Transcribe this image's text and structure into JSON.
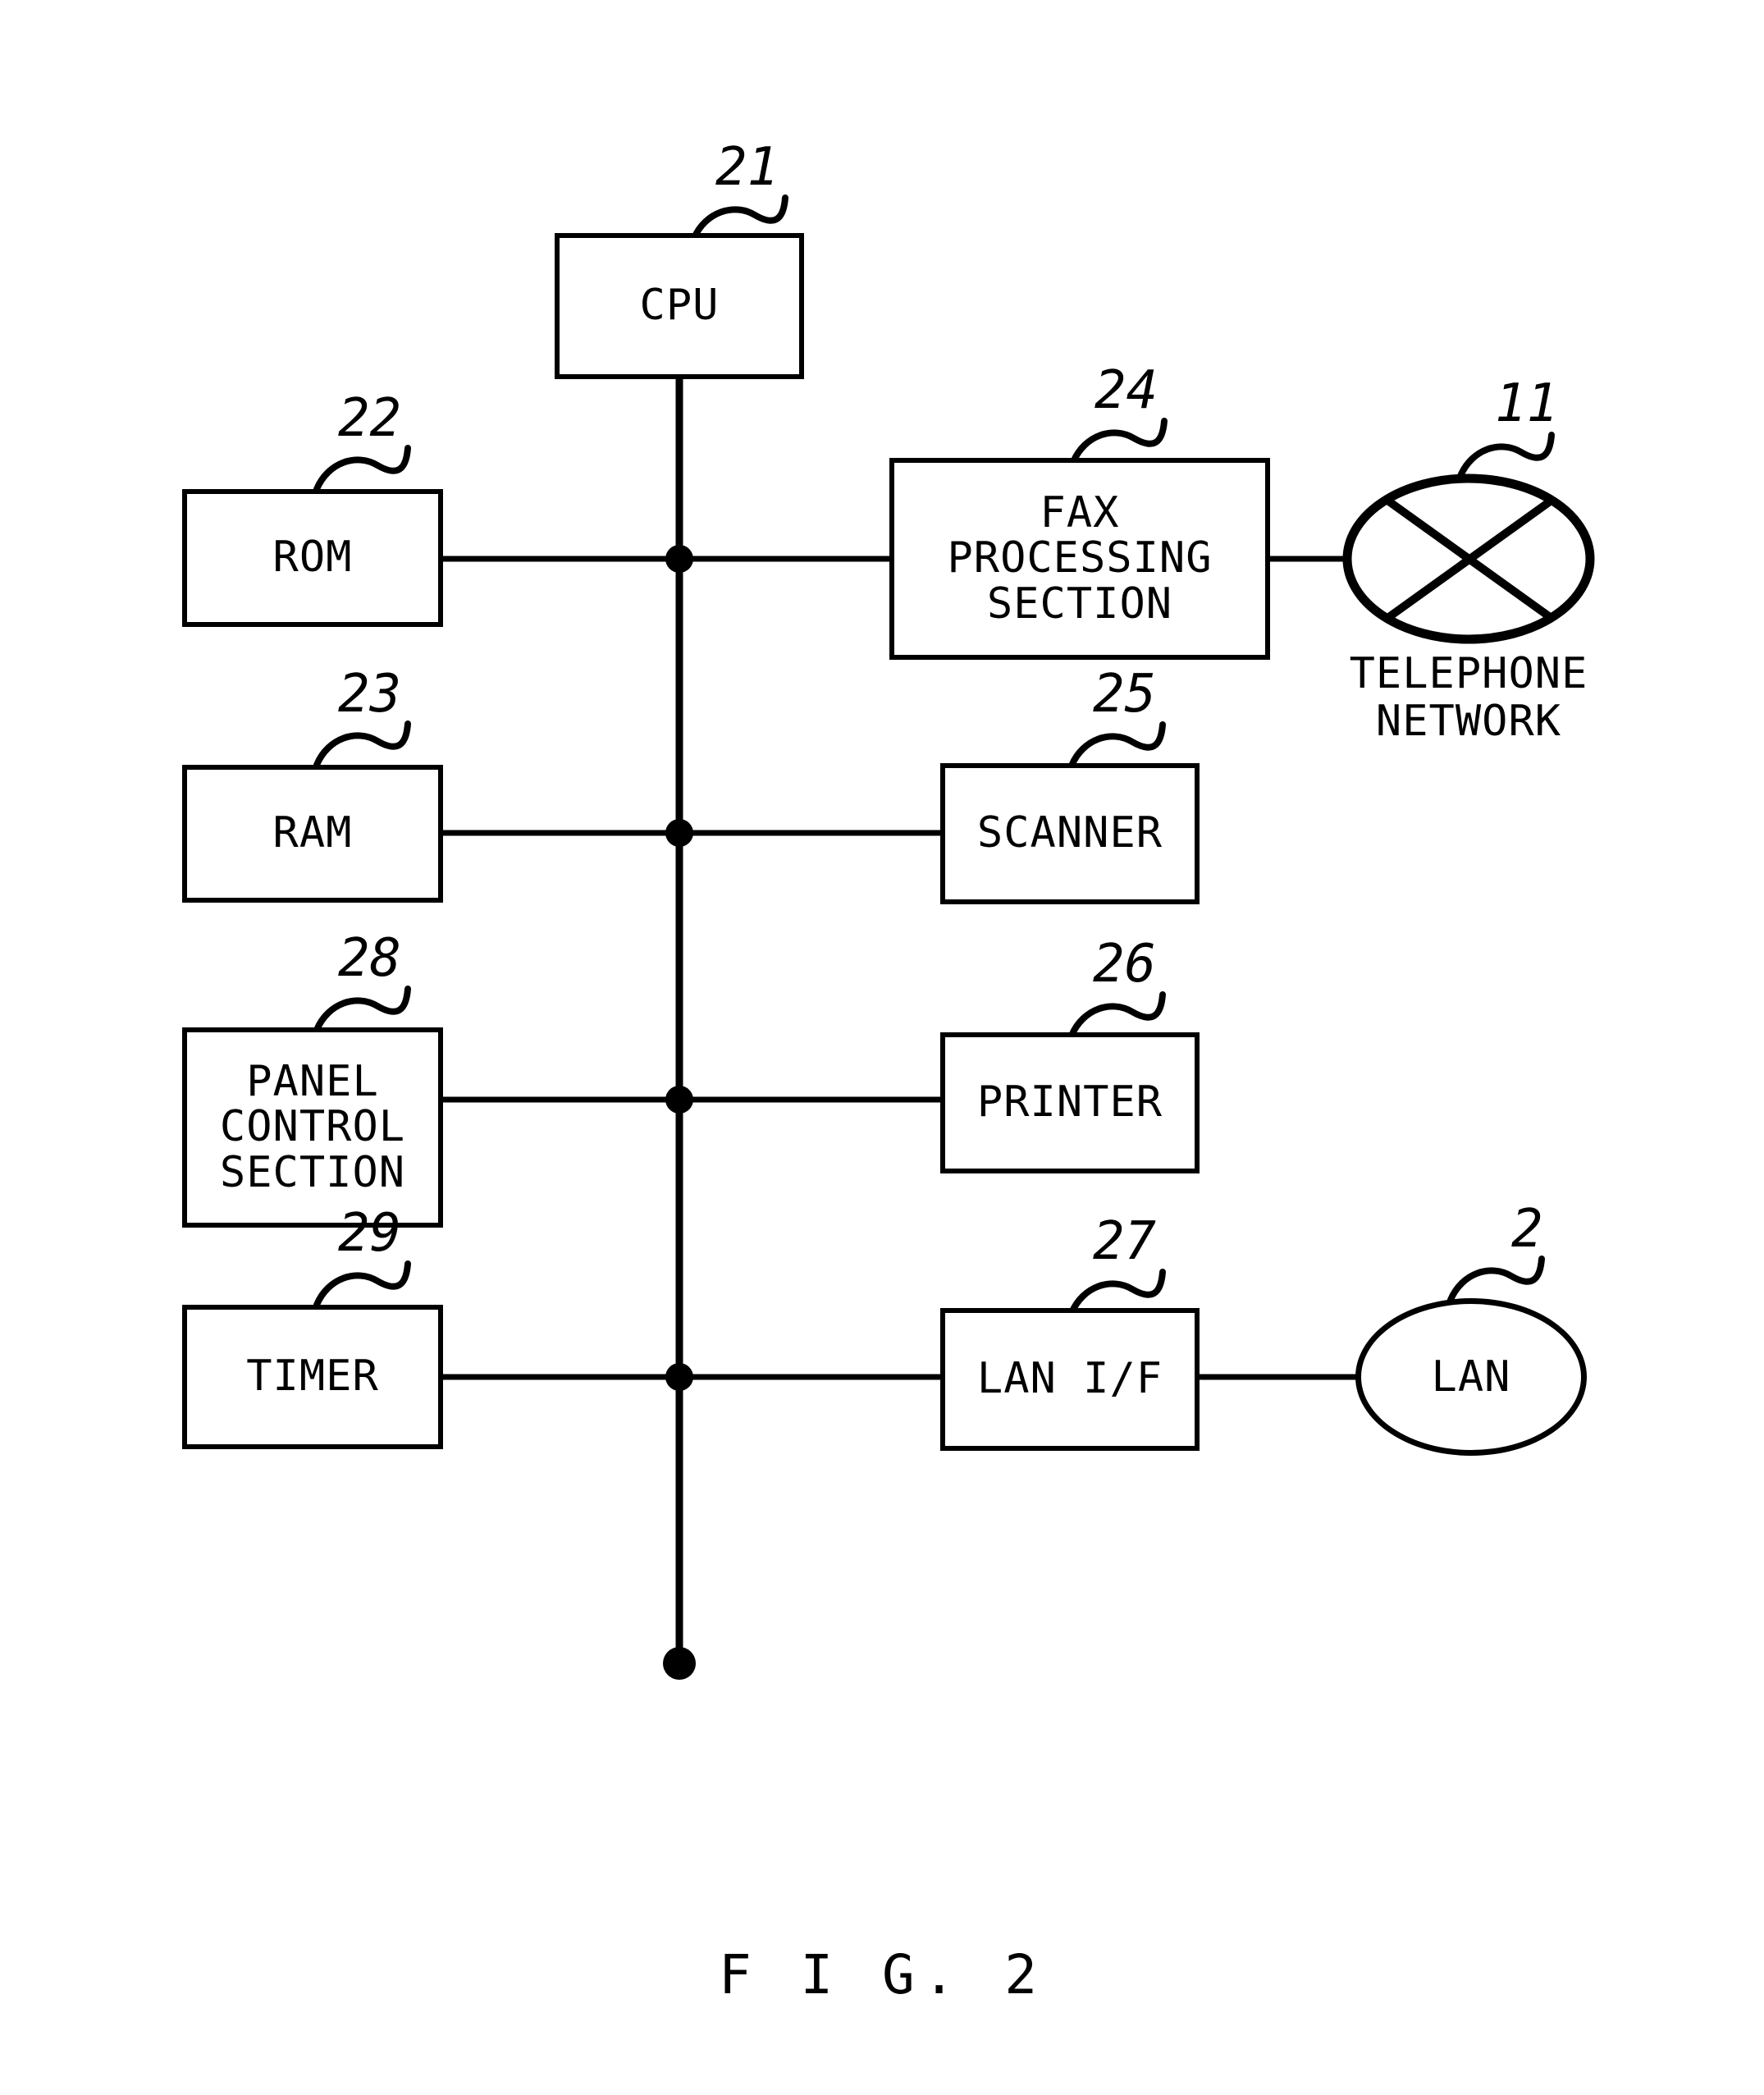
{
  "figure": {
    "caption": "F I G. 2",
    "background_color": "#ffffff",
    "line_color": "#000000"
  },
  "nodes": {
    "cpu": {
      "label": "CPU",
      "ref": "21"
    },
    "rom": {
      "label": "ROM",
      "ref": "22"
    },
    "ram": {
      "label": "RAM",
      "ref": "23"
    },
    "fax": {
      "label": "FAX\nPROCESSING\nSECTION",
      "ref": "24"
    },
    "scanner": {
      "label": "SCANNER",
      "ref": "25"
    },
    "printer": {
      "label": "PRINTER",
      "ref": "26"
    },
    "lan_if": {
      "label": "LAN I/F",
      "ref": "27"
    },
    "panel": {
      "label": "PANEL\nCONTROL\nSECTION",
      "ref": "28"
    },
    "timer": {
      "label": "TIMER",
      "ref": "29"
    },
    "telephone": {
      "label": "",
      "caption": "TELEPHONE\nNETWORK",
      "ref": "11"
    },
    "lan": {
      "label": "LAN",
      "ref": "2"
    }
  },
  "bus": {
    "junction_count": 4,
    "terminal_dot": true
  }
}
